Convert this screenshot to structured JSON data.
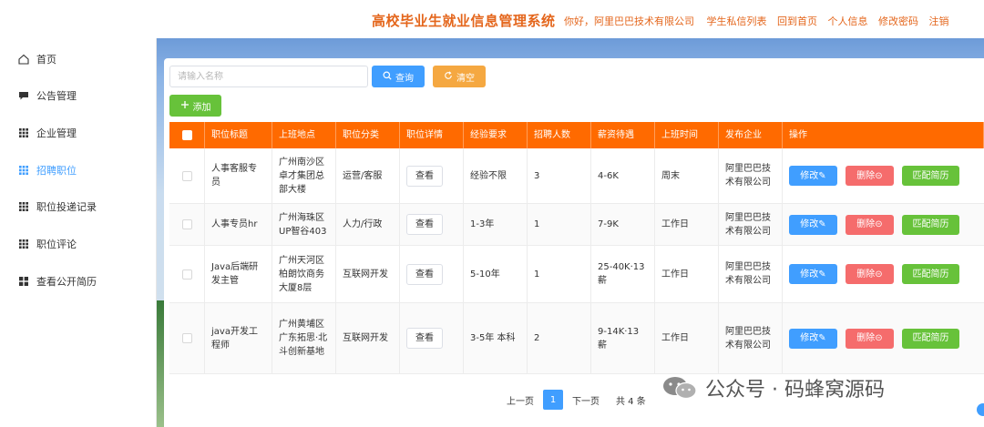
{
  "header": {
    "title": "高校毕业生就业信息管理系统",
    "greeting": "你好，阿里巴巴技术有限公司",
    "links": [
      "学生私信列表",
      "回到首页",
      "个人信息",
      "修改密码",
      "注销"
    ]
  },
  "sidebar": {
    "items": [
      {
        "label": "首页",
        "icon": "home-icon"
      },
      {
        "label": "公告管理",
        "icon": "comment-icon"
      },
      {
        "label": "企业管理",
        "icon": "grid-icon"
      },
      {
        "label": "招聘职位",
        "icon": "grid-icon",
        "active": true
      },
      {
        "label": "职位投递记录",
        "icon": "grid-icon"
      },
      {
        "label": "职位评论",
        "icon": "grid-icon"
      },
      {
        "label": "查看公开简历",
        "icon": "tiles-icon"
      }
    ]
  },
  "toolbar": {
    "search_placeholder": "请输入名称",
    "search_value": "",
    "query_label": "查询",
    "clear_label": "清空",
    "add_label": "添加"
  },
  "table": {
    "columns": [
      "职位标题",
      "上班地点",
      "职位分类",
      "职位详情",
      "经验要求",
      "招聘人数",
      "薪资待遇",
      "上班时间",
      "发布企业",
      "操作"
    ],
    "rows": [
      {
        "title": "人事客服专员",
        "location": "广州南沙区卓才集团总部大楼",
        "category": "运营/客服",
        "detail": "查看",
        "experience": "经验不限",
        "headcount": "3",
        "salary": "4-6K",
        "schedule": "周末",
        "company": "阿里巴巴技术有限公司"
      },
      {
        "title": "人事专员hr",
        "location": "广州海珠区UP智谷403",
        "category": "人力/行政",
        "detail": "查看",
        "experience": "1-3年",
        "headcount": "1",
        "salary": "7-9K",
        "schedule": "工作日",
        "company": "阿里巴巴技术有限公司"
      },
      {
        "title": "Java后端研发主管",
        "location": "广州天河区柏朗饮商务大厦8层",
        "category": "互联网开发",
        "detail": "查看",
        "experience": "5-10年",
        "headcount": "1",
        "salary": "25-40K·13薪",
        "schedule": "工作日",
        "company": "阿里巴巴技术有限公司"
      },
      {
        "title": "java开发工程师",
        "location": "广州黄埔区广东拓思·北斗创新基地",
        "category": "互联网开发",
        "detail": "查看",
        "experience": "3-5年 本科",
        "headcount": "2",
        "salary": "9-14K·13薪",
        "schedule": "工作日",
        "company": "阿里巴巴技术有限公司"
      }
    ],
    "actions": {
      "edit": "修改",
      "delete": "删除",
      "match": "匹配简历"
    }
  },
  "pagination": {
    "prev": "上一页",
    "current": "1",
    "next": "下一页",
    "total": "共 4 条"
  },
  "watermark": {
    "text": "公众号 · 码蜂窝源码"
  },
  "colors": {
    "accent": "#409eff",
    "header_orange": "#ff6a00",
    "title_orange": "#e4661c",
    "danger": "#f56c6c",
    "success": "#67c23a",
    "warning": "#f5a841"
  }
}
